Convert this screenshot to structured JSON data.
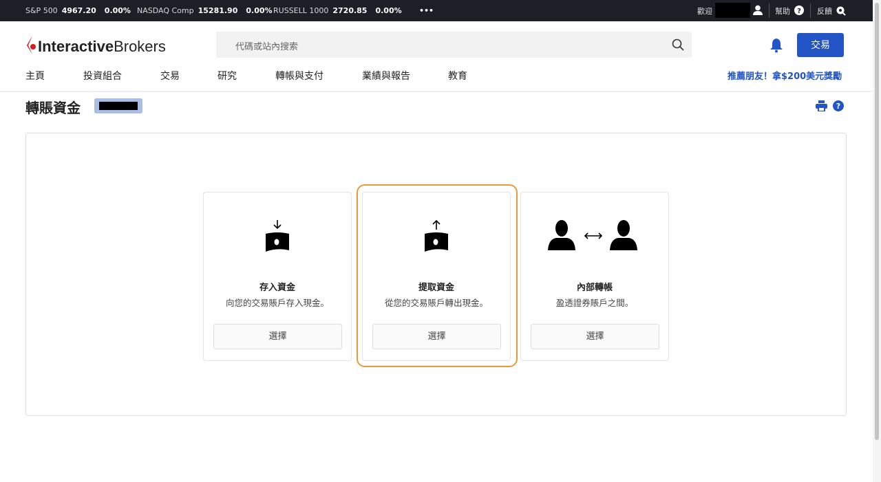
{
  "ticker": [
    {
      "name": "S&P 500",
      "value": "4967.20",
      "change": "0.00%"
    },
    {
      "name": "NASDAQ Comp",
      "value": "15281.90",
      "change": "0.00%"
    },
    {
      "name": "RUSSELL 1000",
      "value": "2720.85",
      "change": "0.00%"
    }
  ],
  "topbar": {
    "more": "•••",
    "welcome": "歡迎",
    "help": "幫助",
    "feedback": "反饋"
  },
  "header": {
    "logo_bold": "Interactive",
    "logo_rest": "Brokers",
    "search_placeholder": "代碼或站內搜索",
    "trade_button": "交易"
  },
  "nav": [
    "主頁",
    "投資組合",
    "交易",
    "研究",
    "轉帳與支付",
    "業績與報告",
    "教育"
  ],
  "promo": "推薦朋友！拿$200美元獎勵",
  "page": {
    "title": "轉賬資金"
  },
  "cards": [
    {
      "title": "存入資金",
      "desc": "向您的交易賬戶存入現金。",
      "button": "選擇",
      "icon": "deposit-icon"
    },
    {
      "title": "提取資金",
      "desc": "從您的交易賬戶轉出現金。",
      "button": "選擇",
      "icon": "withdraw-icon"
    },
    {
      "title": "內部轉帳",
      "desc": "盈透證券賬戶之間。",
      "button": "選擇",
      "icon": "internal-transfer-icon"
    }
  ],
  "colors": {
    "brand": "#2254c5",
    "highlight": "#e89a3a",
    "topbar": "#1c1f26"
  }
}
